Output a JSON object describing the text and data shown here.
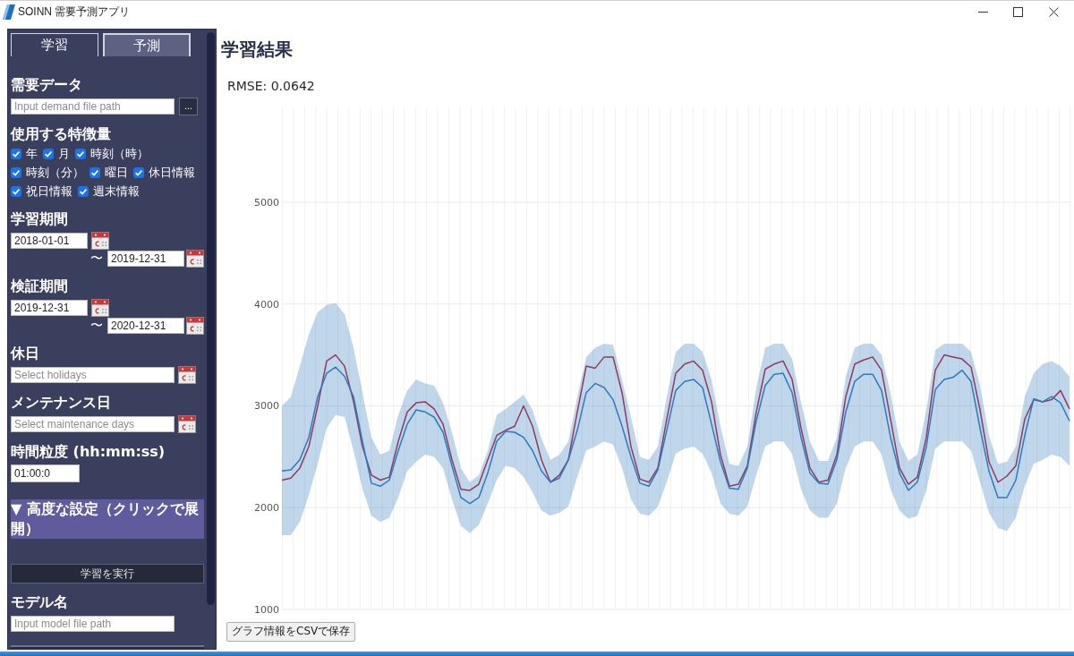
{
  "window": {
    "title": "SOINN 需要予測アプリ"
  },
  "sidebar": {
    "tabs": [
      {
        "label": "学習",
        "selected": true
      },
      {
        "label": "予測",
        "selected": false
      }
    ],
    "sections": [
      {
        "kind": "file",
        "heading": "需要データ",
        "placeholder": "Input demand file path",
        "button": "..."
      },
      {
        "kind": "checks",
        "heading": "使用する特徴量",
        "options": [
          {
            "label": "年",
            "checked": true
          },
          {
            "label": "月",
            "checked": true
          },
          {
            "label": "時刻（時）",
            "checked": true
          },
          {
            "label": "時刻（分）",
            "checked": true
          },
          {
            "label": "曜日",
            "checked": true
          },
          {
            "label": "休日情報",
            "checked": true
          },
          {
            "label": "祝日情報",
            "checked": true
          },
          {
            "label": "週末情報",
            "checked": true
          }
        ]
      },
      {
        "kind": "range",
        "heading": "学習期間",
        "start": "2018-01-01",
        "separator": "〜",
        "end": "2019-12-31"
      },
      {
        "kind": "range",
        "heading": "検証期間",
        "start": "2019-12-31",
        "separator": "〜",
        "end": "2020-12-31"
      },
      {
        "kind": "date_picker",
        "heading": "休日",
        "placeholder": "Select holidays"
      },
      {
        "kind": "date_picker",
        "heading": "メンテナンス日",
        "placeholder": "Select maintenance days"
      },
      {
        "kind": "time",
        "heading": "時間粒度 (hh:mm:ss)",
        "value": "01:00:0"
      },
      {
        "kind": "toggle",
        "label": "▼ 高度な設定（クリックで展開）"
      },
      {
        "kind": "button",
        "label": "学習を実行"
      },
      {
        "kind": "file",
        "heading": "モデル名",
        "placeholder": "Input model file path"
      },
      {
        "kind": "partial_button"
      }
    ]
  },
  "main": {
    "title": "学習結果",
    "metric": "RMSE: 0.0642",
    "chart_data": {
      "type": "line",
      "grid": true,
      "ylim": [
        1000,
        5940
      ],
      "yticks": [
        1000,
        2000,
        3000,
        4000,
        5000
      ],
      "series": [
        {
          "color": "#8e3b5f",
          "values": [
            2270,
            2290,
            2390,
            2600,
            3000,
            3440,
            3500,
            3390,
            3040,
            2600,
            2320,
            2270,
            2300,
            2650,
            2940,
            3030,
            3040,
            2970,
            2820,
            2470,
            2180,
            2170,
            2230,
            2470,
            2710,
            2760,
            2800,
            3000,
            2800,
            2470,
            2250,
            2320,
            2470,
            2940,
            3390,
            3370,
            3480,
            3480,
            3130,
            2600,
            2280,
            2250,
            2390,
            2870,
            3320,
            3410,
            3440,
            3350,
            3040,
            2520,
            2210,
            2230,
            2410,
            2940,
            3360,
            3410,
            3440,
            3260,
            2780,
            2390,
            2250,
            2270,
            2520,
            3090,
            3410,
            3450,
            3480,
            3350,
            2870,
            2390,
            2230,
            2300,
            2690,
            3350,
            3500,
            3480,
            3460,
            3380,
            2960,
            2450,
            2250,
            2310,
            2410,
            2870,
            3060,
            3040,
            3060,
            3150,
            2970
          ]
        },
        {
          "color": "#2f79bd",
          "values": [
            2360,
            2370,
            2470,
            2690,
            3090,
            3320,
            3380,
            3290,
            3090,
            2650,
            2240,
            2210,
            2270,
            2560,
            2820,
            2960,
            2940,
            2890,
            2740,
            2410,
            2100,
            2040,
            2100,
            2340,
            2650,
            2750,
            2740,
            2690,
            2560,
            2360,
            2250,
            2290,
            2470,
            2760,
            3130,
            3220,
            3180,
            3060,
            2800,
            2500,
            2240,
            2210,
            2370,
            2760,
            3150,
            3240,
            3260,
            3180,
            2820,
            2450,
            2190,
            2180,
            2390,
            2850,
            3200,
            3310,
            3320,
            3130,
            2690,
            2340,
            2240,
            2230,
            2470,
            2940,
            3240,
            3310,
            3310,
            3150,
            2690,
            2340,
            2170,
            2250,
            2600,
            3160,
            3260,
            3280,
            3350,
            3240,
            2780,
            2360,
            2100,
            2100,
            2270,
            2710,
            3070,
            3040,
            3090,
            3030,
            2850
          ],
          "lower": [
            1730,
            1730,
            1860,
            2120,
            2430,
            2780,
            2910,
            2890,
            2560,
            2180,
            1920,
            1860,
            1900,
            2100,
            2360,
            2450,
            2520,
            2500,
            2390,
            2080,
            1820,
            1750,
            1830,
            2040,
            2270,
            2410,
            2390,
            2300,
            2150,
            1970,
            1920,
            1950,
            2010,
            2300,
            2560,
            2600,
            2650,
            2620,
            2390,
            2080,
            1940,
            1920,
            2010,
            2250,
            2530,
            2580,
            2600,
            2530,
            2340,
            2040,
            1940,
            1920,
            2010,
            2320,
            2600,
            2650,
            2650,
            2530,
            2180,
            1970,
            1900,
            1900,
            2040,
            2390,
            2600,
            2650,
            2650,
            2520,
            2180,
            1970,
            1890,
            1920,
            2170,
            2580,
            2650,
            2650,
            2650,
            2560,
            2250,
            1950,
            1800,
            1770,
            1900,
            2210,
            2430,
            2470,
            2520,
            2500,
            2410
          ],
          "upper": [
            3000,
            3090,
            3390,
            3700,
            3920,
            3990,
            4010,
            3900,
            3570,
            3130,
            2690,
            2520,
            2560,
            2910,
            3150,
            3260,
            3220,
            3200,
            3030,
            2740,
            2390,
            2250,
            2320,
            2560,
            2910,
            2970,
            3040,
            3110,
            2960,
            2680,
            2470,
            2520,
            2650,
            3090,
            3480,
            3570,
            3610,
            3600,
            3260,
            2890,
            2500,
            2470,
            2600,
            3090,
            3530,
            3610,
            3610,
            3530,
            3260,
            2800,
            2430,
            2410,
            2600,
            3180,
            3570,
            3610,
            3610,
            3460,
            3040,
            2650,
            2460,
            2460,
            2690,
            3290,
            3570,
            3610,
            3610,
            3500,
            3130,
            2650,
            2460,
            2520,
            2960,
            3550,
            3610,
            3610,
            3610,
            3530,
            3200,
            2710,
            2430,
            2450,
            2600,
            3090,
            3320,
            3410,
            3440,
            3390,
            3290
          ]
        }
      ]
    },
    "save_button": "グラフ情報をCSVで保存"
  }
}
